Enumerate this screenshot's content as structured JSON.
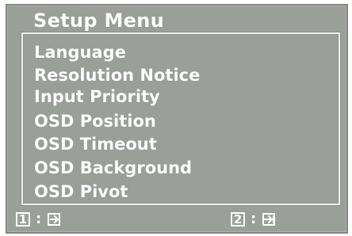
{
  "menu": {
    "title": "Setup Menu",
    "items": [
      "Language",
      "Resolution Notice",
      "Input Priority",
      "OSD Position",
      "OSD Timeout",
      "OSD Background",
      "OSD Pivot"
    ]
  },
  "legend": {
    "key1": {
      "label": "1",
      "separator": ":",
      "icon": "exit-icon"
    },
    "key2": {
      "label": "2",
      "separator": ":",
      "icon": "enter-icon"
    }
  },
  "colors": {
    "panel_bg": "#9a9f9a",
    "text": "#ffffff"
  }
}
